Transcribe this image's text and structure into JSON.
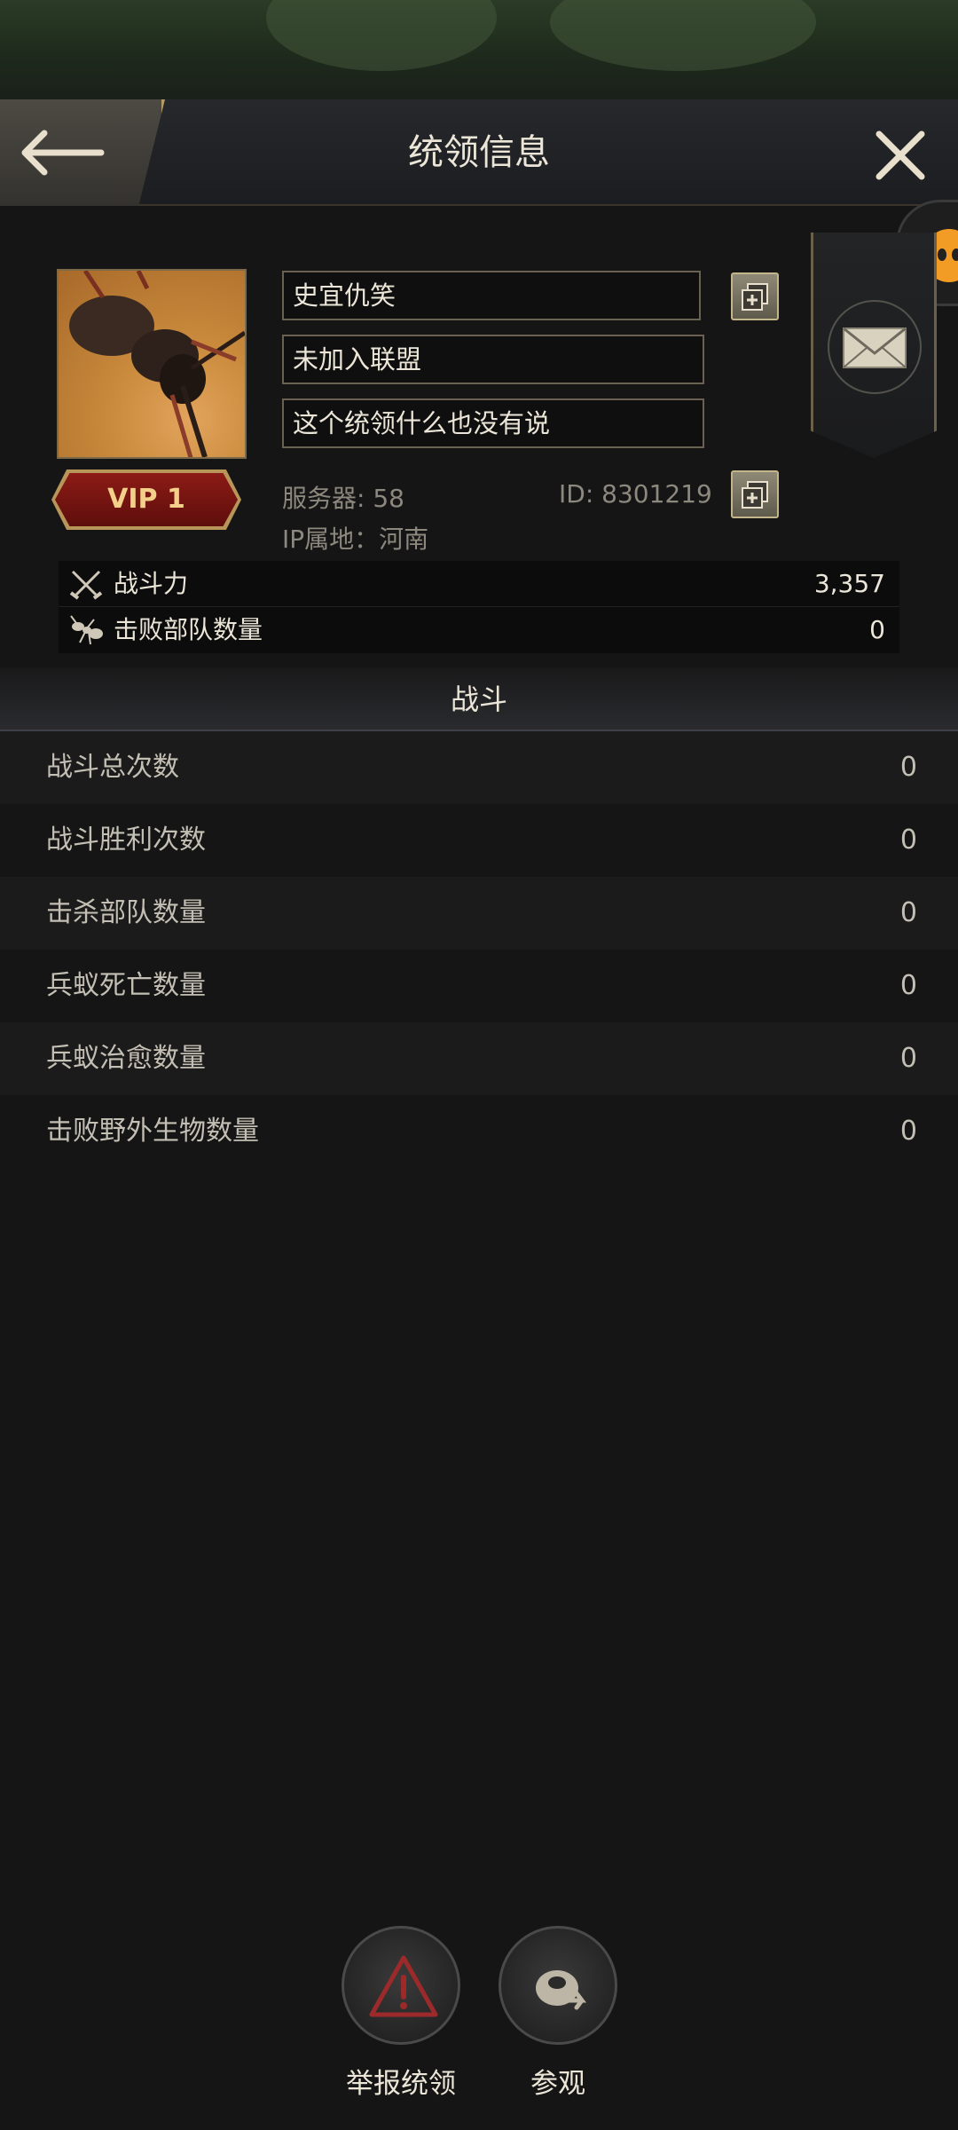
{
  "header": {
    "title": "统领信息"
  },
  "profile": {
    "name": "史宜仇笑",
    "alliance": "未加入联盟",
    "signature": "这个统领什么也没有说",
    "vip_label": "VIP 1",
    "server": "服务器: 58",
    "player_id": "ID: 8301219",
    "ip_location": "IP属地：河南"
  },
  "summary": [
    {
      "label": "战斗力",
      "value": "3,357",
      "icon": "crossed-swords-icon"
    },
    {
      "label": "击败部队数量",
      "value": "0",
      "icon": "ant-icon"
    }
  ],
  "section": {
    "title": "战斗"
  },
  "battle_stats": [
    {
      "label": "战斗总次数",
      "value": "0"
    },
    {
      "label": "战斗胜利次数",
      "value": "0"
    },
    {
      "label": "击杀部队数量",
      "value": "0"
    },
    {
      "label": "兵蚁死亡数量",
      "value": "0"
    },
    {
      "label": "兵蚁治愈数量",
      "value": "0"
    },
    {
      "label": "击败野外生物数量",
      "value": "0"
    }
  ],
  "actions": {
    "report_label": "举报统领",
    "visit_label": "参观"
  },
  "colors": {
    "accent_gold": "#b8965a",
    "vip_red": "#8c1b16",
    "warning_red": "#9c2a2a"
  }
}
